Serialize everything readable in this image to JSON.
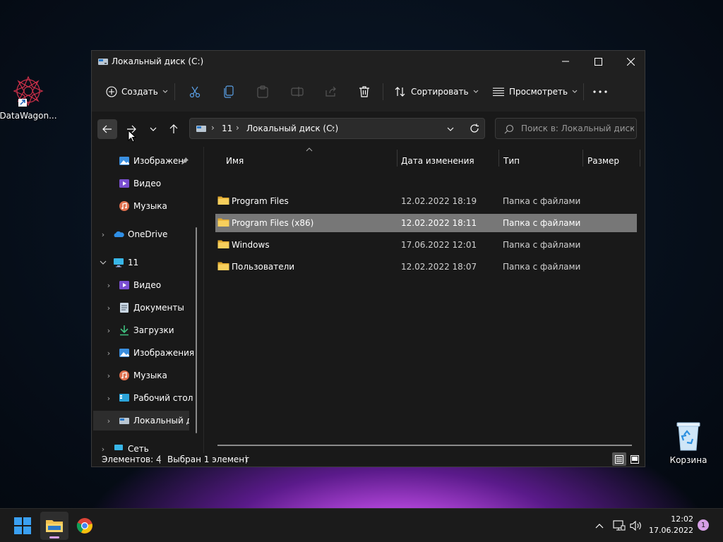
{
  "desktop": {
    "icons": [
      {
        "label": "DataWagon...",
        "icon": "datawagon-app-icon"
      },
      {
        "label": "Корзина",
        "icon": "recycle-bin-icon"
      }
    ]
  },
  "window": {
    "title": "Локальный диск (C:)",
    "controls": {
      "minimize": "minimize-icon",
      "maximize": "maximize-icon",
      "close": "close-icon"
    }
  },
  "toolbar": {
    "create_label": "Создать",
    "sort_label": "Сортировать",
    "view_label": "Просмотреть",
    "more": "more-icon"
  },
  "address": {
    "crumbs": [
      "11",
      "Локальный диск (C:)"
    ]
  },
  "search": {
    "placeholder": "Поиск в: Локальный диск (..."
  },
  "sidebar": {
    "items": [
      {
        "label": "Изображен",
        "icon": "pictures-icon",
        "pinned": true
      },
      {
        "label": "Видео",
        "icon": "video-icon"
      },
      {
        "label": "Музыка",
        "icon": "music-icon"
      },
      {
        "label": "OneDrive",
        "icon": "onedrive-icon"
      },
      {
        "label": "11",
        "icon": "computer-icon"
      },
      {
        "label": "Видео",
        "icon": "video-icon"
      },
      {
        "label": "Документы",
        "icon": "documents-icon"
      },
      {
        "label": "Загрузки",
        "icon": "downloads-icon"
      },
      {
        "label": "Изображения",
        "icon": "pictures-icon"
      },
      {
        "label": "Музыка",
        "icon": "music-icon"
      },
      {
        "label": "Рабочий стол",
        "icon": "desktop-icon"
      },
      {
        "label": "Локальный ди",
        "icon": "drive-icon"
      },
      {
        "label": "Сеть",
        "icon": "network-icon"
      }
    ]
  },
  "table": {
    "columns": [
      "Имя",
      "Дата изменения",
      "Тип",
      "Размер"
    ],
    "rows": [
      {
        "name": "Program Files",
        "date": "12.02.2022 18:19",
        "type": "Папка с файлами",
        "size": ""
      },
      {
        "name": "Program Files (x86)",
        "date": "12.02.2022 18:11",
        "type": "Папка с файлами",
        "size": ""
      },
      {
        "name": "Windows",
        "date": "17.06.2022 12:01",
        "type": "Папка с файлами",
        "size": ""
      },
      {
        "name": "Пользователи",
        "date": "12.02.2022 18:07",
        "type": "Папка с файлами",
        "size": ""
      }
    ]
  },
  "status": {
    "count": "Элементов: 4",
    "selected": "Выбран 1 элемент"
  },
  "taskbar": {
    "time": "12:02",
    "date": "17.06.2022",
    "notifications": "1"
  },
  "colors": {
    "accent": "#0078d4",
    "selection": "#777777",
    "folder": "#f2c14e"
  }
}
